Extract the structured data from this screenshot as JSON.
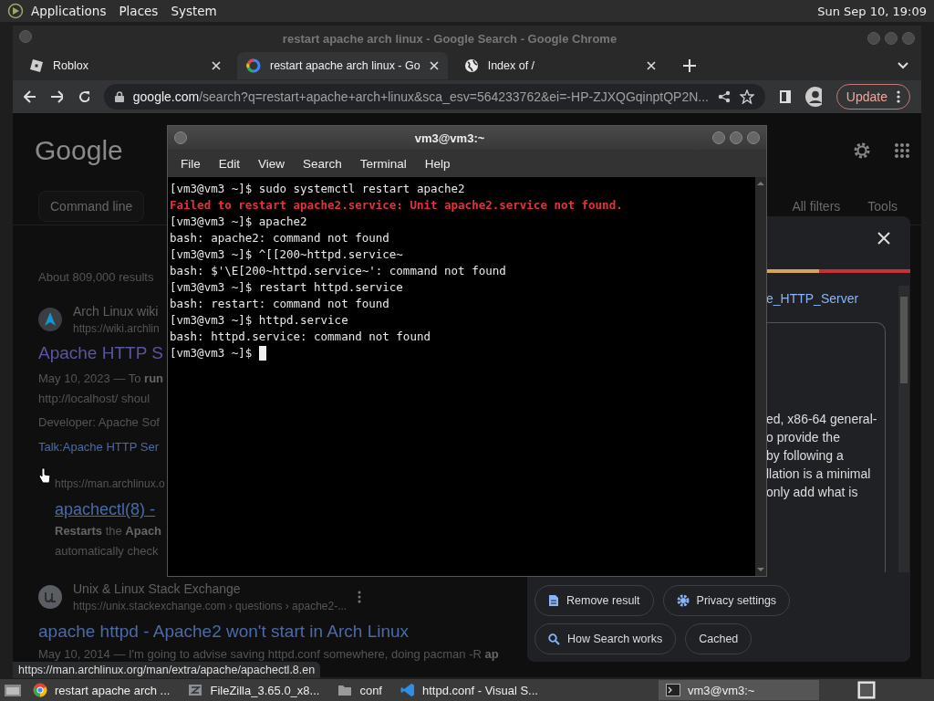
{
  "top_panel": {
    "menus": [
      "Applications",
      "Places",
      "System"
    ],
    "clock": "Sun Sep 10, 19:09"
  },
  "browser": {
    "title": "restart apache arch linux - Google Search - Google Chrome",
    "tabs": [
      {
        "label": "Roblox",
        "kind": "roblox",
        "selected": false
      },
      {
        "label": "restart apache arch linux - Go",
        "kind": "google",
        "selected": true
      },
      {
        "label": "Index of /",
        "kind": "globe",
        "selected": false
      }
    ],
    "address": {
      "host": "google.com",
      "path": "/search?q=restart+apache+arch+linux&sca_esv=564233762&ei=-HP-ZJXQGqinptQP2N..."
    },
    "update_button": "Update"
  },
  "search_page": {
    "logo": "Google",
    "chips": [
      "Command line",
      "All filters",
      "Tools"
    ],
    "results_count": "About 809,000 results",
    "results": [
      {
        "site": "Arch Linux wiki",
        "url": "https://wiki.archlin",
        "kind": "arch",
        "title": "Apache HTTP S",
        "snippet": [
          "May 10, 2023 — To **run**",
          "http://localhost/ shoul"
        ],
        "meta": "Developer: Apache Sof",
        "sublink": "Talk:Apache HTTP Ser",
        "subresult": {
          "url": "https://man.archlinux.o",
          "title": "apachectl(8) -",
          "snippet": [
            "**Restarts** the **Apach**",
            "automatically check"
          ]
        }
      },
      {
        "site": "Unix & Linux Stack Exchange",
        "url": "https://unix.stackexchange.com › questions › apache2-...",
        "kind": "unix",
        "title": "apache httpd - Apache2 won't start in Arch Linux",
        "snippet": [
          "May 10, 2014 — I'm going to advise saving httpd.conf somewhere, doing pacman -R **ap**"
        ]
      }
    ]
  },
  "about_panel": {
    "link": "e_HTTP_Server",
    "text": [
      "ed, x86-64 general-",
      "o provide the",
      "by following a",
      "llation is a minimal",
      "only add what is"
    ],
    "buttons": [
      {
        "label": "Remove result",
        "kind": "doc"
      },
      {
        "label": "Privacy settings",
        "kind": "gear"
      },
      {
        "label": "How Search works",
        "kind": "search"
      },
      {
        "label": "Cached",
        "kind": "plain"
      }
    ]
  },
  "terminal": {
    "title": "vm3@vm3:~",
    "menus": [
      "File",
      "Edit",
      "View",
      "Search",
      "Terminal",
      "Help"
    ],
    "lines": [
      {
        "text": "[vm3@vm3 ~]$ sudo systemctl restart apache2",
        "kind": "normal"
      },
      {
        "text": "Failed to restart apache2.service: Unit apache2.service not found.",
        "kind": "error"
      },
      {
        "text": "[vm3@vm3 ~]$ apache2",
        "kind": "normal"
      },
      {
        "text": "bash: apache2: command not found",
        "kind": "normal"
      },
      {
        "text": "[vm3@vm3 ~]$ ^[[200~httpd.service~",
        "kind": "normal"
      },
      {
        "text": "bash: $'\\E[200~httpd.service~': command not found",
        "kind": "normal"
      },
      {
        "text": "[vm3@vm3 ~]$ restart httpd.service",
        "kind": "normal"
      },
      {
        "text": "bash: restart: command not found",
        "kind": "normal"
      },
      {
        "text": "[vm3@vm3 ~]$ httpd.service",
        "kind": "normal"
      },
      {
        "text": "bash: httpd.service: command not found",
        "kind": "normal"
      },
      {
        "text": "[vm3@vm3 ~]$",
        "kind": "prompt"
      }
    ]
  },
  "status_url": "https://man.archlinux.org/man/extra/apache/apachectl.8.en",
  "taskbar": {
    "items": [
      {
        "label": "restart apache arch ...",
        "kind": "chrome",
        "selected": false
      },
      {
        "label": "FileZilla_3.65.0_x8...",
        "kind": "filezilla",
        "selected": false
      },
      {
        "label": "conf",
        "kind": "folder",
        "selected": false
      },
      {
        "label": "httpd.conf - Visual S...",
        "kind": "vscode",
        "selected": false
      },
      {
        "label": "vm3@vm3:~",
        "kind": "terminal",
        "selected": true
      }
    ]
  }
}
